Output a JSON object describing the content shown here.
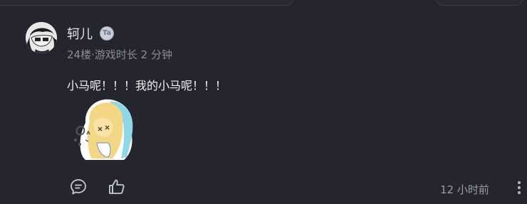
{
  "comment": {
    "username": "轲儿",
    "badge_text": "Ta",
    "floor": "24楼",
    "separator": "·",
    "play_time": "游戏时长 2 分钟",
    "content": "小马呢！！！我的小马呢！！！",
    "timestamp": "12 小时前"
  },
  "icons": {
    "comment": "comment-icon",
    "like": "thumbs-up-icon",
    "more": "more-vertical-icon"
  }
}
